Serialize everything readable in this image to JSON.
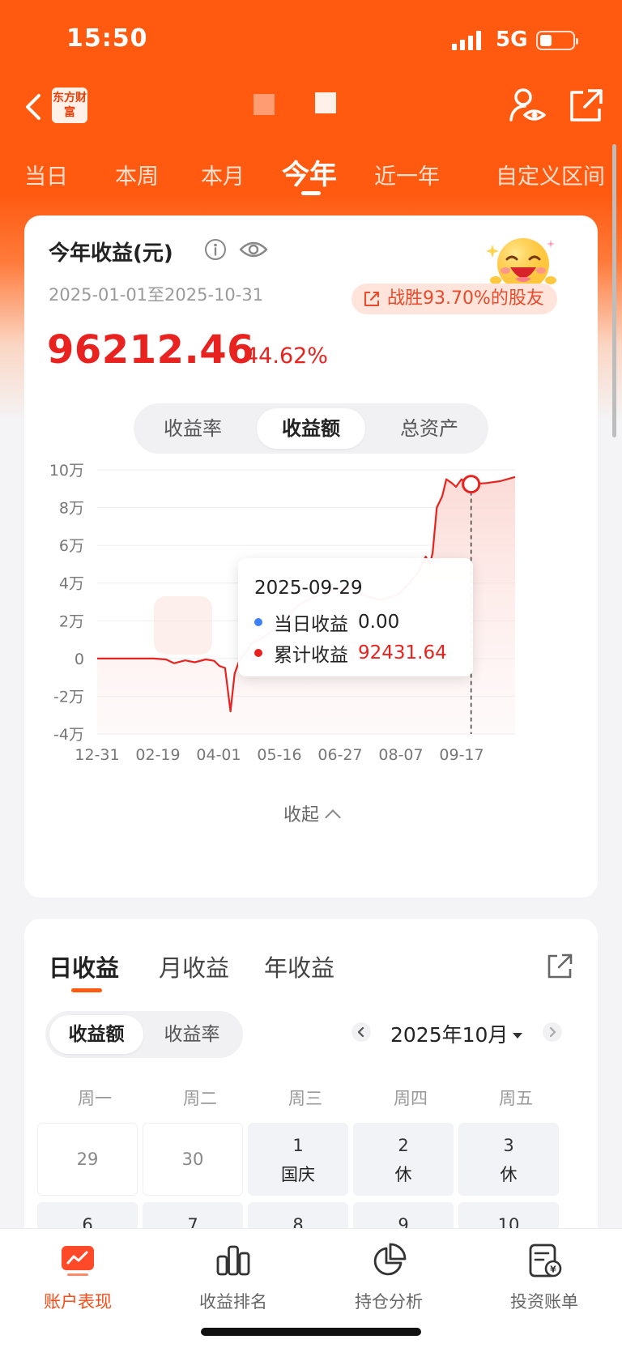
{
  "status_bar": {
    "time": "15:50",
    "network": "5G",
    "battery_level": 0.35
  },
  "nav": {
    "logo_text": "东方财富"
  },
  "period_tabs": [
    "当日",
    "本周",
    "本月",
    "今年",
    "近一年",
    "自定义区间"
  ],
  "active_period": 3,
  "summary": {
    "title": "今年收益(元)",
    "date_range": "2025-01-01至2025-10-31",
    "badge": "战胜93.70%的股友",
    "total": "96212.46",
    "rate": "44.62%"
  },
  "chart_tabs": [
    "收益率",
    "收益额",
    "总资产"
  ],
  "active_chart_tab": 1,
  "chart_data": {
    "type": "line",
    "x_labels": [
      "12-31",
      "02-19",
      "04-01",
      "05-16",
      "06-27",
      "08-07",
      "09-17"
    ],
    "y_labels": [
      "10万",
      "8万",
      "6万",
      "4万",
      "2万",
      "0",
      "-2万",
      "-4万"
    ],
    "ylim": [
      -40000,
      100000
    ],
    "grid": true,
    "points": [
      [
        "2024-12-31",
        0
      ],
      [
        "2025-01-20",
        0
      ],
      [
        "2025-02-10",
        0
      ],
      [
        "2025-02-19",
        -500
      ],
      [
        "2025-02-25",
        -2500
      ],
      [
        "2025-03-05",
        -1000
      ],
      [
        "2025-03-12",
        -2000
      ],
      [
        "2025-03-20",
        -500
      ],
      [
        "2025-03-26",
        -1200
      ],
      [
        "2025-03-30",
        -4000
      ],
      [
        "2025-04-03",
        -5000
      ],
      [
        "2025-04-07",
        -28000
      ],
      [
        "2025-04-10",
        -8000
      ],
      [
        "2025-04-14",
        0
      ],
      [
        "2025-04-18",
        3000
      ],
      [
        "2025-04-22",
        8000
      ],
      [
        "2025-04-28",
        10000
      ],
      [
        "2025-05-08",
        15000
      ],
      [
        "2025-05-16",
        20000
      ],
      [
        "2025-05-26",
        28000
      ],
      [
        "2025-06-05",
        32000
      ],
      [
        "2025-06-12",
        34000
      ],
      [
        "2025-06-20",
        36000
      ],
      [
        "2025-06-27",
        38000
      ],
      [
        "2025-07-07",
        36000
      ],
      [
        "2025-07-15",
        33000
      ],
      [
        "2025-07-25",
        31000
      ],
      [
        "2025-08-07",
        34000
      ],
      [
        "2025-08-15",
        40000
      ],
      [
        "2025-08-22",
        46000
      ],
      [
        "2025-08-27",
        54000
      ],
      [
        "2025-08-30",
        50000
      ],
      [
        "2025-09-01",
        56000
      ],
      [
        "2025-09-04",
        80000
      ],
      [
        "2025-09-08",
        86000
      ],
      [
        "2025-09-11",
        95000
      ],
      [
        "2025-09-15",
        93000
      ],
      [
        "2025-09-18",
        91000
      ],
      [
        "2025-09-22",
        95000
      ],
      [
        "2025-09-25",
        93000
      ],
      [
        "2025-09-29",
        92431.64
      ],
      [
        "2025-10-10",
        93000
      ],
      [
        "2025-10-20",
        94000
      ],
      [
        "2025-10-31",
        96212.46
      ]
    ],
    "highlight": {
      "date": "2025-09-29",
      "value": 92431.64
    },
    "tooltip": {
      "date": "2025-09-29",
      "rows": [
        {
          "label": "当日收益",
          "value": "0.00",
          "dot_color": "#3d7ff5",
          "value_color": "#222222"
        },
        {
          "label": "累计收益",
          "value": "92431.64",
          "dot_color": "#e8231f",
          "value_color": "#e8231f"
        }
      ]
    },
    "line_color": "#e8231f"
  },
  "collapse_label": "收起",
  "daily": {
    "tabs": [
      "日收益",
      "月收益",
      "年收益"
    ],
    "active_tab": 0,
    "modes": [
      "收益额",
      "收益率"
    ],
    "active_mode": 0,
    "month": "2025年10月",
    "weekdays": [
      "周一",
      "周二",
      "周三",
      "周四",
      "周五"
    ],
    "cells": [
      {
        "num": "29",
        "note": "",
        "muted": true
      },
      {
        "num": "30",
        "note": "",
        "muted": true
      },
      {
        "num": "1",
        "note": "国庆",
        "muted": false
      },
      {
        "num": "2",
        "note": "休",
        "muted": false
      },
      {
        "num": "3",
        "note": "休",
        "muted": false
      },
      {
        "num": "6",
        "note": "",
        "muted": false
      },
      {
        "num": "7",
        "note": "",
        "muted": false
      },
      {
        "num": "8",
        "note": "",
        "muted": false
      },
      {
        "num": "9",
        "note": "",
        "muted": false
      },
      {
        "num": "10",
        "note": "",
        "muted": false
      }
    ]
  },
  "bottom_nav": [
    {
      "label": "账户表现",
      "icon": "chart-icon",
      "active": true
    },
    {
      "label": "收益排名",
      "icon": "ranking-icon",
      "active": false
    },
    {
      "label": "持仓分析",
      "icon": "pie-chart-icon",
      "active": false
    },
    {
      "label": "投资账单",
      "icon": "bill-icon",
      "active": false
    }
  ],
  "colors": {
    "brand": "#ff5a10",
    "loss_profit_red": "#e8231f",
    "active_tab": "#ff4a16"
  }
}
